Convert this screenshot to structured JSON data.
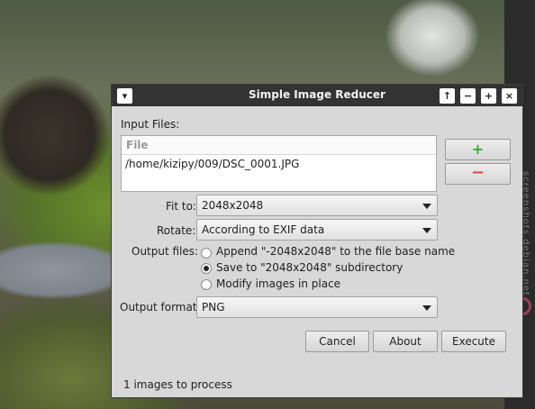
{
  "window": {
    "title": "Simple Image Reducer",
    "menu_button": "▾",
    "up_button": "↑",
    "minimize_button": "−",
    "maximize_button": "+",
    "close_button": "×"
  },
  "input_files": {
    "label": "Input Files:",
    "column_header": "File",
    "files": [
      "/home/kizipy/009/DSC_0001.JPG"
    ],
    "add_icon": "plus-icon",
    "remove_icon": "minus-icon"
  },
  "fit_to": {
    "label": "Fit to:",
    "value": "2048x2048"
  },
  "rotate": {
    "label": "Rotate:",
    "value": "According to EXIF data"
  },
  "output_files": {
    "label": "Output files:",
    "options": [
      "Append \"-2048x2048\" to the file base name",
      "Save to \"2048x2048\" subdirectory",
      "Modify images in place"
    ],
    "selected_index": 1
  },
  "output_format": {
    "label": "Output format:",
    "value": "PNG"
  },
  "buttons": {
    "cancel": "Cancel",
    "about": "About",
    "execute": "Execute"
  },
  "status": "1 images to process",
  "watermark": "screenshots.debian.net"
}
